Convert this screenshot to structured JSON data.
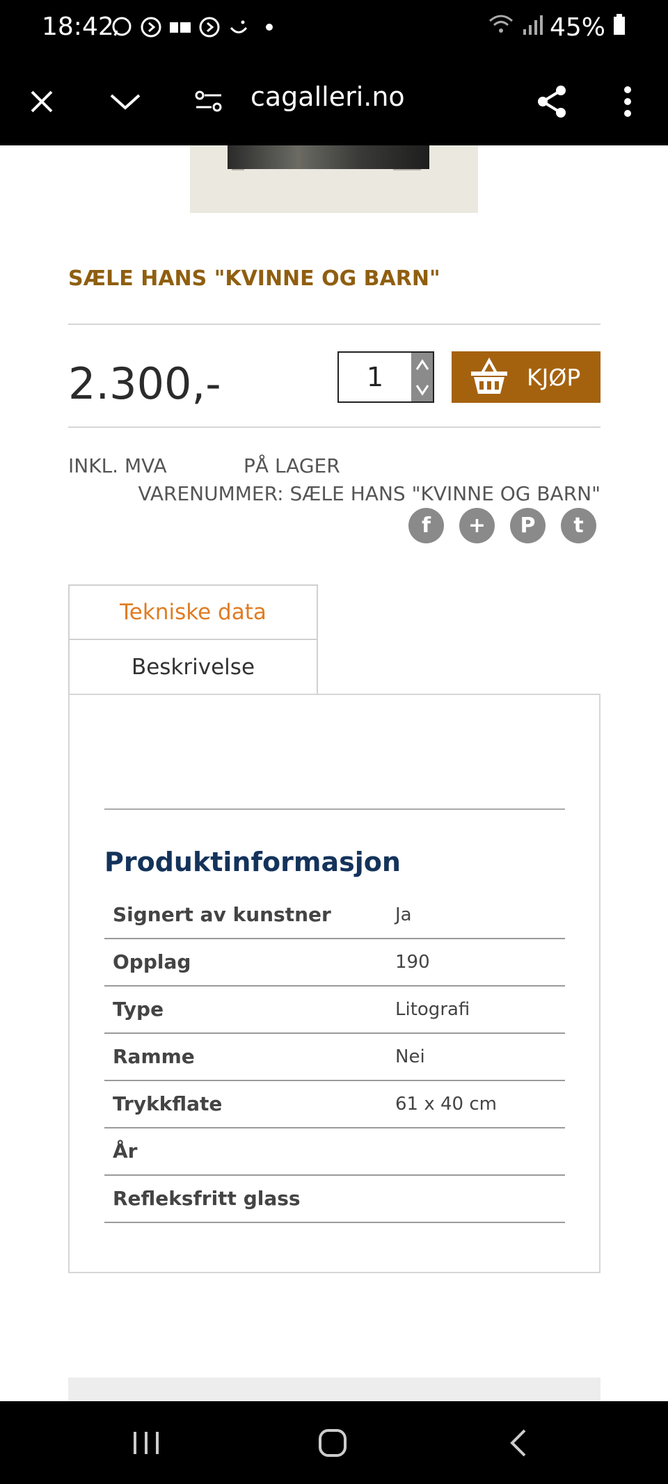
{
  "status_bar": {
    "time": "18:42",
    "battery": "45%"
  },
  "browser": {
    "url": "cagalleri.no"
  },
  "product": {
    "title": "SÆLE HANS \"KVINNE OG BARN\"",
    "price": "2.300,-",
    "quantity": "1",
    "buy_label": "KJØP",
    "vat_label": "INKL. MVA",
    "stock_label": "PÅ LAGER",
    "sku_label": "VARENUMMER: SÆLE HANS \"KVINNE OG BARN\""
  },
  "social": [
    "f",
    "+",
    "P",
    "t"
  ],
  "tabs": {
    "tech": "Tekniske data",
    "desc": "Beskrivelse"
  },
  "panel": {
    "heading": "Produktinformasjon",
    "specs": [
      {
        "key": "Signert av kunstner",
        "value": "Ja"
      },
      {
        "key": "Opplag",
        "value": "190"
      },
      {
        "key": "Type",
        "value": "Litografi"
      },
      {
        "key": "Ramme",
        "value": "Nei"
      },
      {
        "key": "Trykkflate",
        "value": "61 x 40 cm"
      },
      {
        "key": "År",
        "value": ""
      },
      {
        "key": "Refleksfritt glass",
        "value": ""
      }
    ]
  },
  "colors": {
    "title": "#8f5f10",
    "buy_button": "#a5620e",
    "active_tab": "#e07c22",
    "heading": "#14335b"
  }
}
